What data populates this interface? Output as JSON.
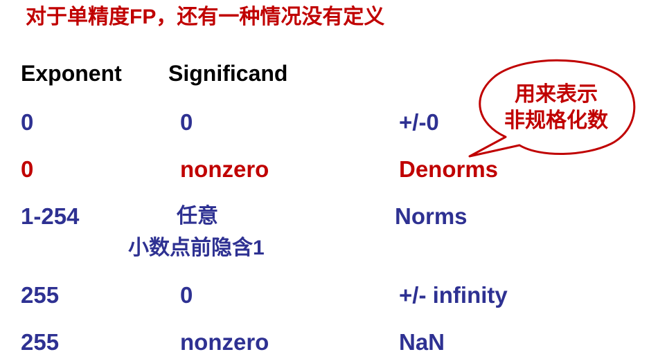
{
  "title": "对于单精度FP，还有一种情况没有定义",
  "headers": {
    "exponent": "Exponent",
    "significand": "Significand"
  },
  "rows": [
    {
      "exponent": "0",
      "significand": "0",
      "meaning": "+/-0"
    },
    {
      "exponent": "0",
      "significand": "nonzero",
      "meaning": "Denorms"
    },
    {
      "exponent": "1-254",
      "significand": "任意",
      "note": "小数点前隐含1",
      "meaning": "Norms"
    },
    {
      "exponent": "255",
      "significand": "0",
      "meaning": "+/- infinity"
    },
    {
      "exponent": "255",
      "significand": "nonzero",
      "meaning": "NaN"
    }
  ],
  "callout": {
    "line1": "用来表示",
    "line2": "非规格化数"
  },
  "colors": {
    "title": "#c00000",
    "header": "#000000",
    "row_text": "#2e3192",
    "highlight": "#c00000",
    "callout_border": "#c00000"
  }
}
